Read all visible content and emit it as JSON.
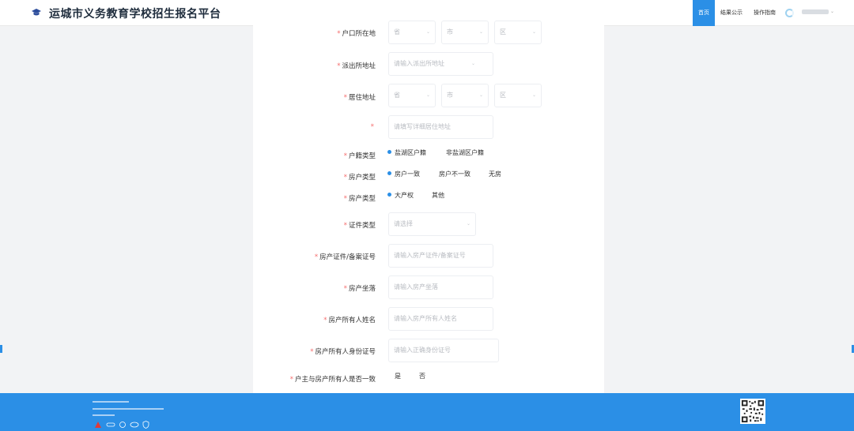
{
  "header": {
    "title": "运城市义务教育学校招生报名平台",
    "nav": [
      {
        "label": "首页",
        "active": true
      },
      {
        "label": "结果公示",
        "active": false
      },
      {
        "label": "操作指南",
        "active": false
      }
    ],
    "user_chevron": "⌄"
  },
  "form": {
    "hukou_location": {
      "label": "户口所在地",
      "province": "省",
      "city": "市",
      "district": "区"
    },
    "police_station": {
      "label": "派出所地址",
      "placeholder": "请输入派出所地址"
    },
    "residence": {
      "label": "居住地址",
      "province": "省",
      "city": "市",
      "district": "区"
    },
    "residence_detail": {
      "label": "",
      "placeholder": "请填写详细居住地址"
    },
    "household_type": {
      "label": "户籍类型",
      "options": [
        "盐湖区户籍",
        "非盐湖区户籍"
      ],
      "selected": 0
    },
    "housing_type": {
      "label": "房户类型",
      "options": [
        "房户一致",
        "房户不一致",
        "无房"
      ],
      "selected": 0
    },
    "property_type": {
      "label": "房产类型",
      "options": [
        "大产权",
        "其他"
      ],
      "selected": 0
    },
    "id_type": {
      "label": "证件类型",
      "placeholder": "请选择"
    },
    "property_cert": {
      "label": "房产证件/备案证号",
      "placeholder": "请输入房产证件/备案证号"
    },
    "property_location": {
      "label": "房产坐落",
      "placeholder": "请输入房产坐落"
    },
    "owner_name": {
      "label": "房产所有人姓名",
      "placeholder": "请输入房产所有人姓名"
    },
    "owner_id": {
      "label": "房产所有人身份证号",
      "placeholder": "请输入正确身份证号"
    },
    "owner_match": {
      "label": "户主与房产所有人是否一致",
      "options": [
        "是",
        "否"
      ]
    }
  },
  "colors": {
    "primary": "#2b8fe6",
    "required": "#f56c6c"
  }
}
